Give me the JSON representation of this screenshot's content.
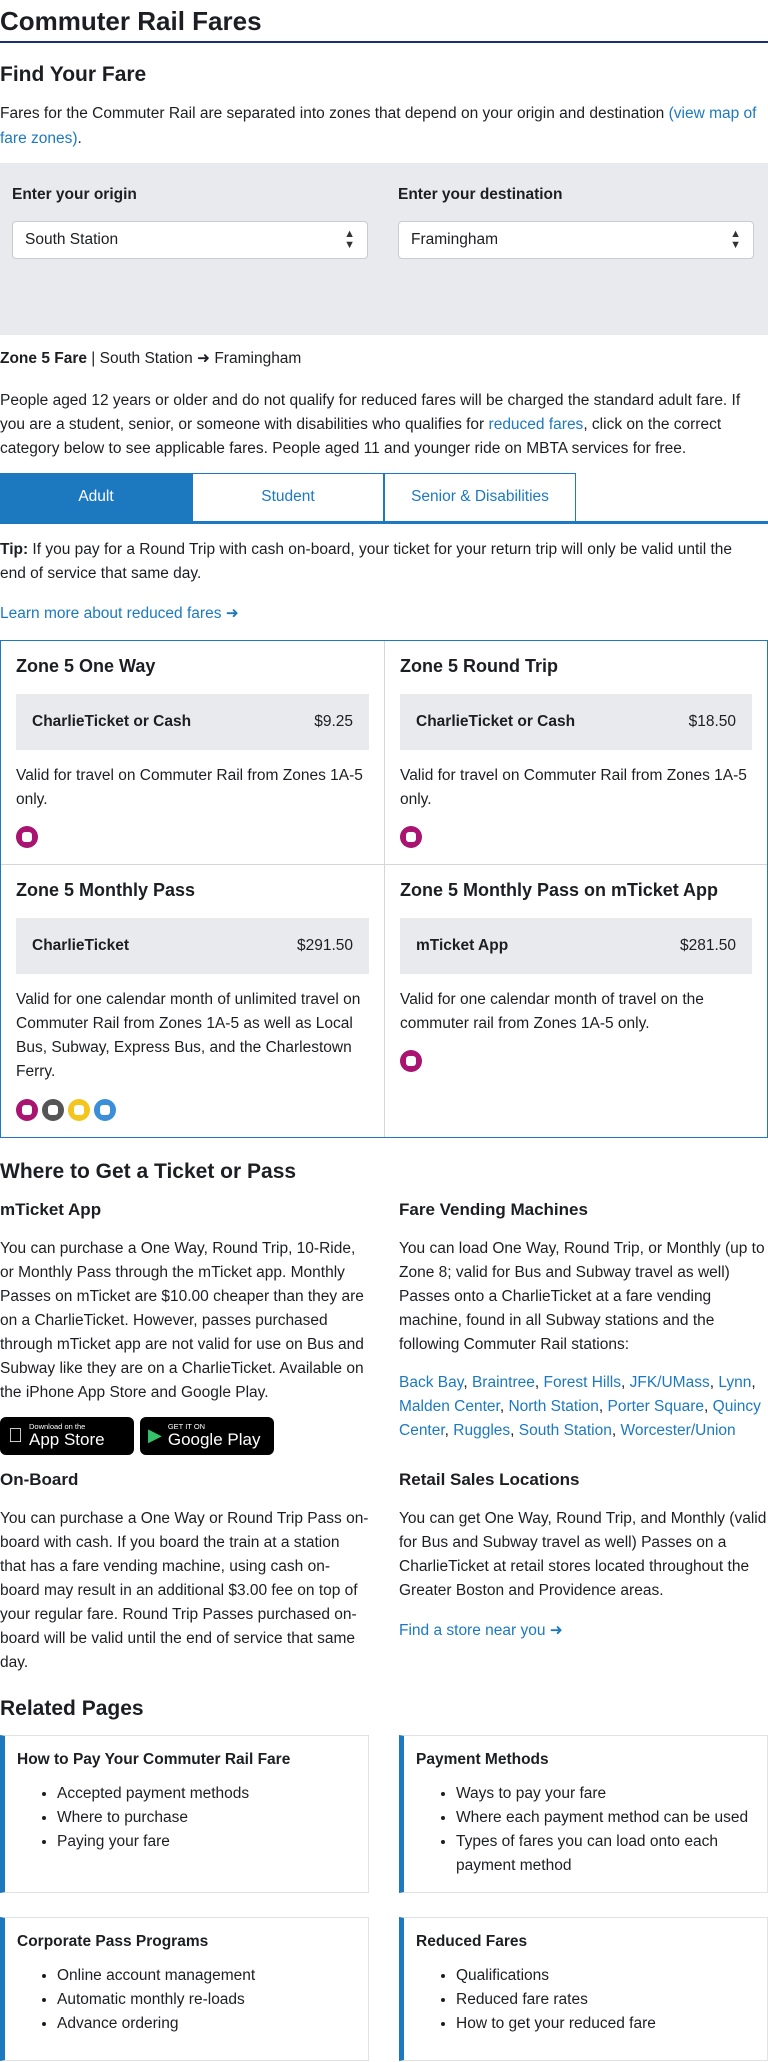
{
  "page_title": "Commuter Rail Fares",
  "find": {
    "title": "Find Your Fare",
    "intro": "Fares for the Commuter Rail are separated into zones that depend on your origin and destination",
    "map_link": "(view map of fare zones)",
    "period": ".",
    "origin_label": "Enter your origin",
    "origin_value": "South Station",
    "destination_label": "Enter your destination",
    "destination_value": "Framingham"
  },
  "summary": {
    "zone": "Zone 5 Fare",
    "sep": " | South Station",
    "to": "Framingham"
  },
  "description": {
    "before": "People aged 12 years or older and do not qualify for reduced fares will be charged the standard adult fare. If you are a student, senior, or someone with disabilities who qualifies for",
    "link": "reduced fares",
    "after": ", click on the correct category below to see applicable fares. People aged 11 and younger ride on MBTA services for free."
  },
  "tabs": [
    "Adult",
    "Student",
    "Senior & Disabilities"
  ],
  "tip": {
    "label": "Tip:",
    "text": " If you pay for a Round Trip with cash on-board, your ticket for your return trip will only be valid until the end of service that same day."
  },
  "learn_more": "Learn more about reduced fares",
  "fares": [
    {
      "title": "Zone 5 One Way",
      "method": "CharlieTicket or Cash",
      "price": "$9.25",
      "desc": "Valid for travel on Commuter Rail from Zones 1A-5 only."
    },
    {
      "title": "Zone 5 Round Trip",
      "method": "CharlieTicket or Cash",
      "price": "$18.50",
      "desc": "Valid for travel on Commuter Rail from Zones 1A-5 only."
    },
    {
      "title": "Zone 5 Monthly Pass",
      "method": "CharlieTicket",
      "price": "$291.50",
      "desc": "Valid for one calendar month of unlimited travel on Commuter Rail from Zones 1A-5 as well as Local Bus, Subway, Express Bus, and the Charlestown Ferry."
    },
    {
      "title": "Zone 5 Monthly Pass on mTicket App",
      "method": "mTicket App",
      "price": "$281.50",
      "desc": "Valid for one calendar month of travel on the commuter rail from Zones 1A-5 only."
    }
  ],
  "where": {
    "title": "Where to Get a Ticket or Pass",
    "mticket": {
      "title": "mTicket App",
      "text": "You can purchase a One Way, Round Trip, 10-Ride, or Monthly Pass through the mTicket app. Monthly Passes on mTicket are $10.00 cheaper than they are on a CharlieTicket. However, passes purchased through mTicket app are not valid for use on Bus and Subway like they are on a CharlieTicket. Available on the iPhone App Store and Google Play.",
      "appstore_small": "Download on the",
      "appstore_big": "App Store",
      "play_small": "GET IT ON",
      "play_big": "Google Play"
    },
    "vending": {
      "title": "Fare Vending Machines",
      "text": "You can load One Way, Round Trip, or Monthly (up to Zone 8; valid for Bus and Subway travel as well) Passes onto a CharlieTicket at a fare vending machine, found in all Subway stations and the following Commuter Rail stations:",
      "stations": [
        "Back Bay",
        "Braintree",
        "Forest Hills",
        "JFK/UMass",
        "Lynn",
        "Malden Center",
        "North Station",
        "Porter Square",
        "Quincy Center",
        "Ruggles",
        "South Station",
        "Worcester/Union"
      ]
    },
    "onboard": {
      "title": "On-Board",
      "text": "You can purchase a One Way or Round Trip Pass on-board with cash. If you board the train at a station that has a fare vending machine, using cash on-board may result in an additional $3.00 fee on top of your regular fare. Round Trip Passes purchased on-board will be valid until the end of service that same day."
    },
    "retail": {
      "title": "Retail Sales Locations",
      "text": "You can get One Way, Round Trip, and Monthly (valid for Bus and Subway travel as well) Passes on a CharlieTicket at retail stores located throughout the Greater Boston and Providence areas.",
      "link": "Find a store near you"
    }
  },
  "related": {
    "title": "Related Pages",
    "cards": [
      {
        "title": "How to Pay Your Commuter Rail Fare",
        "items": [
          "Accepted payment methods",
          "Where to purchase",
          "Paying your fare"
        ]
      },
      {
        "title": "Payment Methods",
        "items": [
          "Ways to pay your fare",
          "Where each payment method can be used",
          "Types of fares you can load onto each payment method"
        ]
      },
      {
        "title": "Corporate Pass Programs",
        "items": [
          "Online account management",
          "Automatic monthly re-loads",
          "Advance ordering"
        ]
      },
      {
        "title": "Reduced Fares",
        "items": [
          "Qualifications",
          "Reduced fare rates",
          "How to get your reduced fare"
        ]
      }
    ]
  },
  "colors": {
    "accent": "#1c79c0",
    "navy": "#1c2f6e",
    "commuter_rail": "#a8146f",
    "bus": "#555555",
    "subway": "#f4c51c",
    "ferry": "#3a8fd8"
  }
}
